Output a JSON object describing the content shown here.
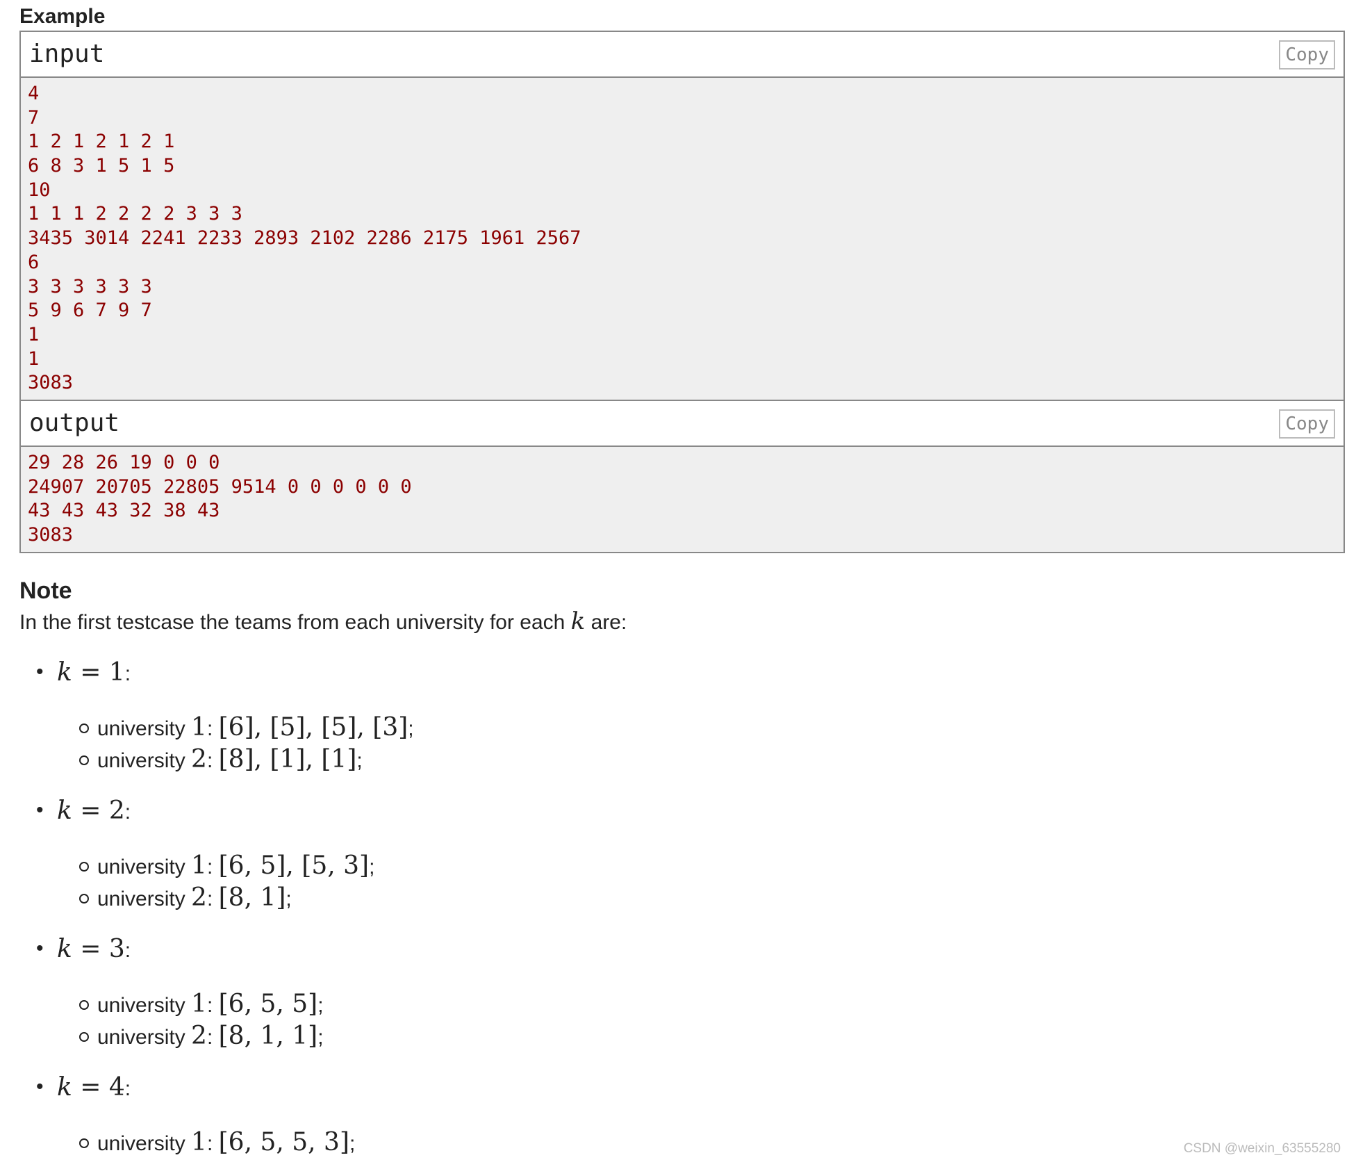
{
  "example": {
    "title": "Example",
    "input": {
      "title": "input",
      "copy_label": "Copy",
      "lines": [
        "4",
        "7",
        "1 2 1 2 1 2 1",
        "6 8 3 1 5 1 5",
        "10",
        "1 1 1 2 2 2 2 3 3 3",
        "3435 3014 2241 2233 2893 2102 2286 2175 1961 2567",
        "6",
        "3 3 3 3 3 3",
        "5 9 6 7 9 7",
        "1",
        "1",
        "3083"
      ]
    },
    "output": {
      "title": "output",
      "copy_label": "Copy",
      "lines": [
        "29 28 26 19 0 0 0",
        "24907 20705 22805 9514 0 0 0 0 0 0",
        "43 43 43 32 38 43",
        "3083"
      ]
    }
  },
  "note": {
    "title": "Note",
    "intro_before": "In the first testcase the teams from each university for each ",
    "intro_var": "k",
    "intro_after": " are:",
    "k_items": [
      {
        "var": "k",
        "eq": " = 1",
        "colon": ":",
        "universities": [
          {
            "word": "university ",
            "num": "1",
            "sep": ": ",
            "value": "[6], [5], [5], [3]",
            "end": ";"
          },
          {
            "word": "university ",
            "num": "2",
            "sep": ": ",
            "value": "[8], [1], [1]",
            "end": ";"
          }
        ]
      },
      {
        "var": "k",
        "eq": " = 2",
        "colon": ":",
        "universities": [
          {
            "word": "university ",
            "num": "1",
            "sep": ": ",
            "value": "[6, 5], [5, 3]",
            "end": ";"
          },
          {
            "word": "university ",
            "num": "2",
            "sep": ": ",
            "value": "[8, 1]",
            "end": ";"
          }
        ]
      },
      {
        "var": "k",
        "eq": " = 3",
        "colon": ":",
        "universities": [
          {
            "word": "university ",
            "num": "1",
            "sep": ": ",
            "value": "[6, 5, 5]",
            "end": ";"
          },
          {
            "word": "university ",
            "num": "2",
            "sep": ": ",
            "value": "[8, 1, 1]",
            "end": ";"
          }
        ]
      },
      {
        "var": "k",
        "eq": " = 4",
        "colon": ":",
        "universities": [
          {
            "word": "university ",
            "num": "1",
            "sep": ": ",
            "value": "[6, 5, 5, 3]",
            "end": ";"
          }
        ]
      }
    ]
  },
  "watermark": "CSDN @weixin_63555280"
}
